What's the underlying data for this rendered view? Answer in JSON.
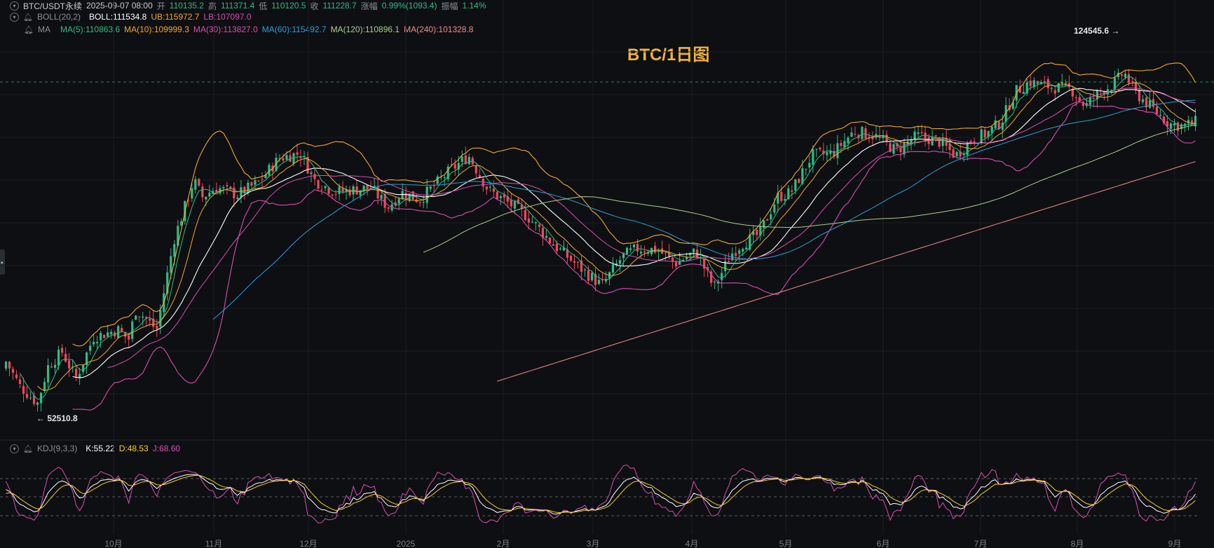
{
  "header": {
    "symbol": "BTC/USDT永续",
    "date": "2025-09-07 08:00",
    "open_label": "开",
    "open": "110135.2",
    "high_label": "高",
    "high": "111371.4",
    "low_label": "低",
    "low": "110120.5",
    "close_label": "收",
    "close": "111228.7",
    "change_label": "涨幅",
    "change": "0.99%(1093.4)",
    "amp_label": "振幅",
    "amp": "1.14%"
  },
  "boll": {
    "name": "BOLL(20,2)",
    "mid": "BOLL:111534.8",
    "ub": "UB:115972.7",
    "lb": "LB:107097.0"
  },
  "ma": {
    "name": "MA",
    "ma5": "MA(5):110863.6",
    "ma10": "MA(10):109999.3",
    "ma30": "MA(30):113827.0",
    "ma60": "MA(60):115492.7",
    "ma120": "MA(120):110896.1",
    "ma240": "MA(240):101328.8"
  },
  "kdj": {
    "name": "KDJ(9,3,3)",
    "k": "K:55.22",
    "d": "D:48.53",
    "j": "J:68.60"
  },
  "colors": {
    "up": "#2ebd85",
    "down": "#f6465d",
    "boll_mid": "#ffffff",
    "boll_ub": "#f0a92e",
    "boll_lb": "#d64fb0",
    "ma5": "#2ebd85",
    "ma10": "#f0a92e",
    "ma30": "#d64fb0",
    "ma60": "#2e9fd8",
    "ma120": "#a8d08d",
    "ma240": "#f08c8c",
    "k": "#ffffff",
    "d": "#f5d020",
    "j": "#d64fb0",
    "title": "#f0b43a"
  },
  "chart_data": {
    "type": "candlestick",
    "title": "BTC/1日图",
    "interval": "1D",
    "x_ticks": [
      "10月",
      "11月",
      "12月",
      "2025",
      "2月",
      "3月",
      "4月",
      "5月",
      "6月",
      "7月",
      "8月",
      "9月"
    ],
    "annotations": [
      {
        "text": "124545.6 →",
        "value": 124545.6,
        "kind": "high"
      },
      {
        "text": "← 52510.8",
        "value": 52510.8,
        "kind": "low"
      }
    ],
    "ylim": [
      50000,
      130000
    ],
    "monthly_close_approx": [
      {
        "month": "2024-09",
        "close": 63300
      },
      {
        "month": "2024-10",
        "close": 70200
      },
      {
        "month": "2024-11",
        "close": 96400
      },
      {
        "month": "2024-12",
        "close": 93400
      },
      {
        "month": "2025-01",
        "close": 102400
      },
      {
        "month": "2025-02",
        "close": 84300
      },
      {
        "month": "2025-03",
        "close": 82500
      },
      {
        "month": "2025-04",
        "close": 94200
      },
      {
        "month": "2025-05",
        "close": 104600
      },
      {
        "month": "2025-06",
        "close": 107100
      },
      {
        "month": "2025-07",
        "close": 115700
      },
      {
        "month": "2025-08",
        "close": 108200
      },
      {
        "month": "2025-09",
        "close": 111228.7
      }
    ],
    "kdj_levels": [
      20,
      50,
      80
    ]
  }
}
